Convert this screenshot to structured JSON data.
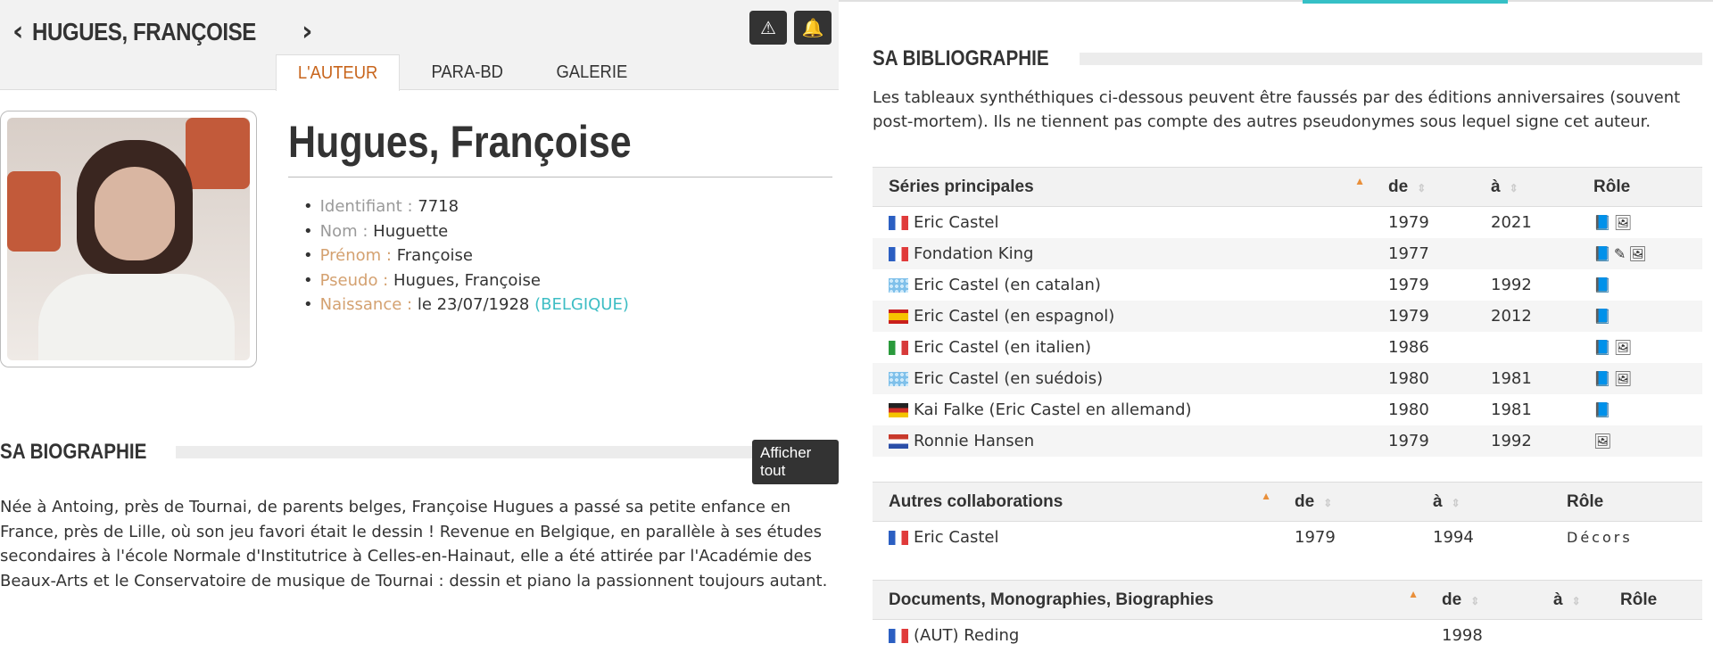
{
  "header": {
    "title": "HUGUES, FRANÇOISE",
    "prev_icon": "chevron-left-icon",
    "next_icon": "chevron-right-icon",
    "alert_icon": "warning-icon",
    "bell_icon": "bell-icon"
  },
  "tabs": [
    {
      "label": "L'AUTEUR",
      "active": true
    },
    {
      "label": "PARA-BD",
      "active": false
    },
    {
      "label": "GALERIE",
      "active": false
    }
  ],
  "profile": {
    "name": "Hugues, Françoise",
    "facts": [
      {
        "key": "Identifiant :",
        "value": "7718"
      },
      {
        "key": "Nom :",
        "value": "Huguette"
      },
      {
        "key": "Prénom :",
        "value": "Françoise"
      },
      {
        "key": "Pseudo :",
        "value": "Hugues, Françoise"
      },
      {
        "key": "Naissance :",
        "value": "le 23/07/1928",
        "link": "(BELGIQUE)"
      }
    ]
  },
  "biography": {
    "title": "SA BIOGRAPHIE",
    "button": "Afficher tout",
    "text": "Née à Antoing, près de Tournai, de parents belges, Françoise Hugues a passé sa petite enfance en France, près de Lille, où son jeu favori était le dessin ! Revenue en Belgique, en parallèle à ses études secondaires à l'école Normale d'Institutrice à Celles-en-Hainaut, elle a été attirée par l'Académie des Beaux-Arts et le Conservatoire de musique de Tournai : dessin et piano la passionnent toujours autant."
  },
  "bibliography": {
    "title": "SA BIBLIOGRAPHIE",
    "disclaimer": "Les tableaux synthéthiques ci-dessous peuvent être faussés par des éditions anniversaires (souvent post-mortem). Ils ne tiennent pas compte des autres pseudonymes sous lequel signe cet auteur.",
    "colors": {
      "accent": "#c8651c",
      "link": "#3dbdc4",
      "dark": "#333333"
    },
    "main_series": {
      "headers": [
        "Séries principales",
        "de",
        "à",
        "Rôle"
      ],
      "rows": [
        {
          "flag": "fr",
          "name": "Eric Castel",
          "from": "1979",
          "to": "2021",
          "roles": "📘🖼"
        },
        {
          "flag": "fr",
          "name": "Fondation King",
          "from": "1977",
          "to": "",
          "roles": "📘✎🖼"
        },
        {
          "flag": "unk",
          "name": "Eric Castel (en catalan)",
          "from": "1979",
          "to": "1992",
          "roles": "📘"
        },
        {
          "flag": "es",
          "name": "Eric Castel (en espagnol)",
          "from": "1979",
          "to": "2012",
          "roles": "📘"
        },
        {
          "flag": "it",
          "name": "Eric Castel (en italien)",
          "from": "1986",
          "to": "",
          "roles": "📘🖼"
        },
        {
          "flag": "unk",
          "name": "Eric Castel (en suédois)",
          "from": "1980",
          "to": "1981",
          "roles": "📘🖼"
        },
        {
          "flag": "de",
          "name": "Kai Falke (Eric Castel en allemand)",
          "from": "1980",
          "to": "1981",
          "roles": "📘"
        },
        {
          "flag": "nl",
          "name": "Ronnie Hansen",
          "from": "1979",
          "to": "1992",
          "roles": "🖼"
        }
      ]
    },
    "collabs": {
      "headers": [
        "Autres collaborations",
        "de",
        "à",
        "Rôle"
      ],
      "rows": [
        {
          "flag": "fr",
          "name": "Eric Castel",
          "from": "1979",
          "to": "1994",
          "roles": "Décors"
        }
      ]
    },
    "docs": {
      "headers": [
        "Documents, Monographies, Biographies",
        "de",
        "à",
        "Rôle"
      ],
      "rows": [
        {
          "flag": "fr",
          "name": "(AUT) Reding",
          "from": "1998",
          "to": "",
          "roles": ""
        }
      ]
    }
  }
}
